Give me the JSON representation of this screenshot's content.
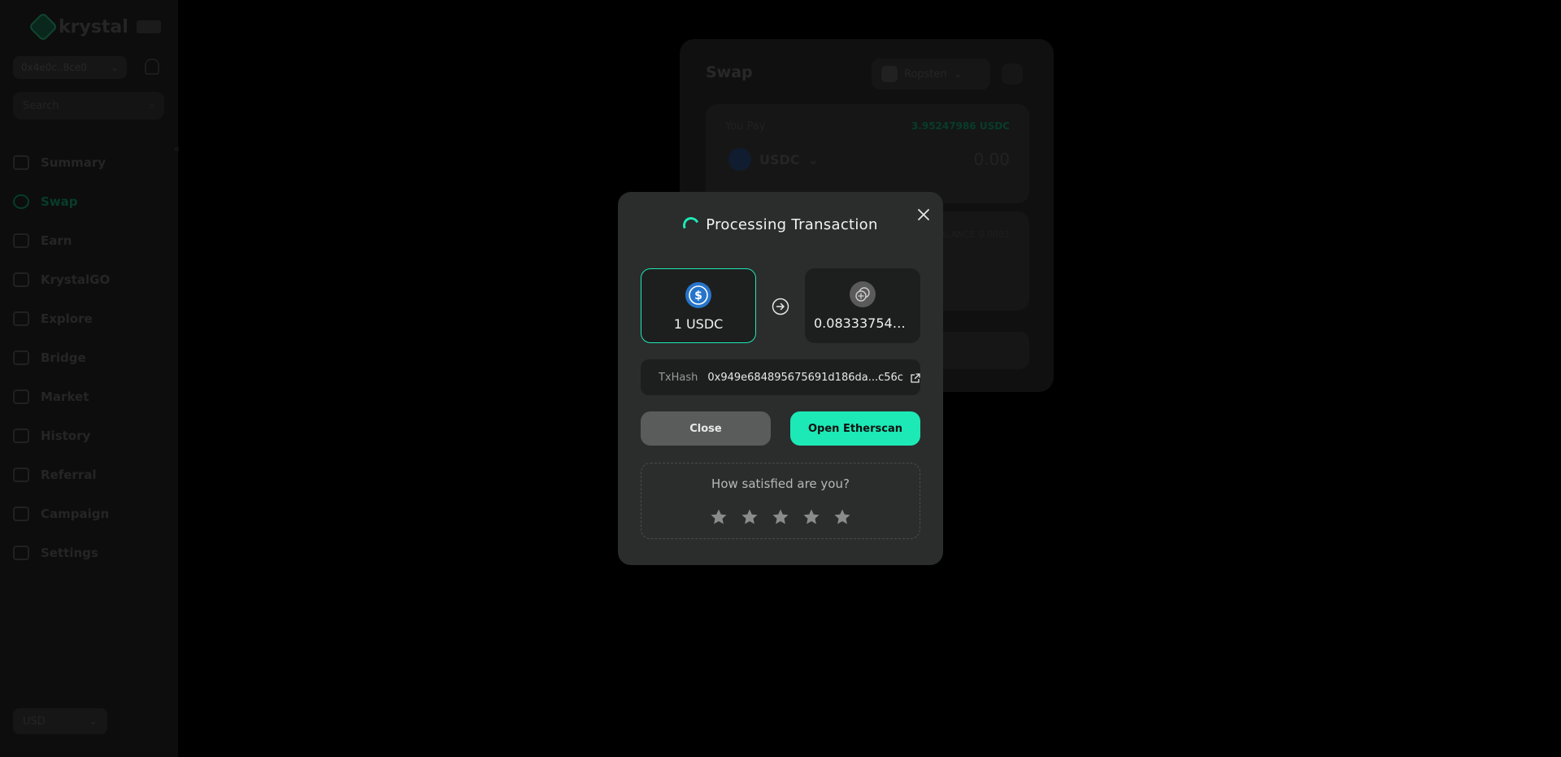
{
  "background": {
    "logo_text": "krystal",
    "wallet_label": "0x4e0c..8ce0",
    "search_placeholder": "Search",
    "nav": [
      "Summary",
      "Swap",
      "Earn",
      "KrystalGO",
      "Explore",
      "Bridge",
      "Market",
      "History",
      "Referral",
      "Campaign",
      "Settings"
    ],
    "currency": "USD",
    "swap_title": "Swap",
    "network": "Ropsten",
    "pay_label": "You Pay",
    "pay_balance": "3.95247986 USDC",
    "pay_token": "USDC",
    "pay_amount": "0.00",
    "recv_label": "BALANCE 0.0082"
  },
  "modal": {
    "title": "Processing Transaction",
    "from_amount": "1 USDC",
    "to_amount": "0.083337544...",
    "tx_label": "TxHash",
    "tx_value": "0x949e684895675691d186da...c56c",
    "close_label": "Close",
    "open_label": "Open Etherscan",
    "rating_question": "How satisfied are you?"
  },
  "colors": {
    "accent": "#1de9b6",
    "modal_bg": "#2b2c2c",
    "card_bg": "#1d1e1e"
  },
  "icons": [
    "close-icon",
    "spinner-icon",
    "usdc-icon",
    "eth-icon",
    "arrow-right-circle-icon",
    "external-link-icon",
    "star-icon"
  ]
}
